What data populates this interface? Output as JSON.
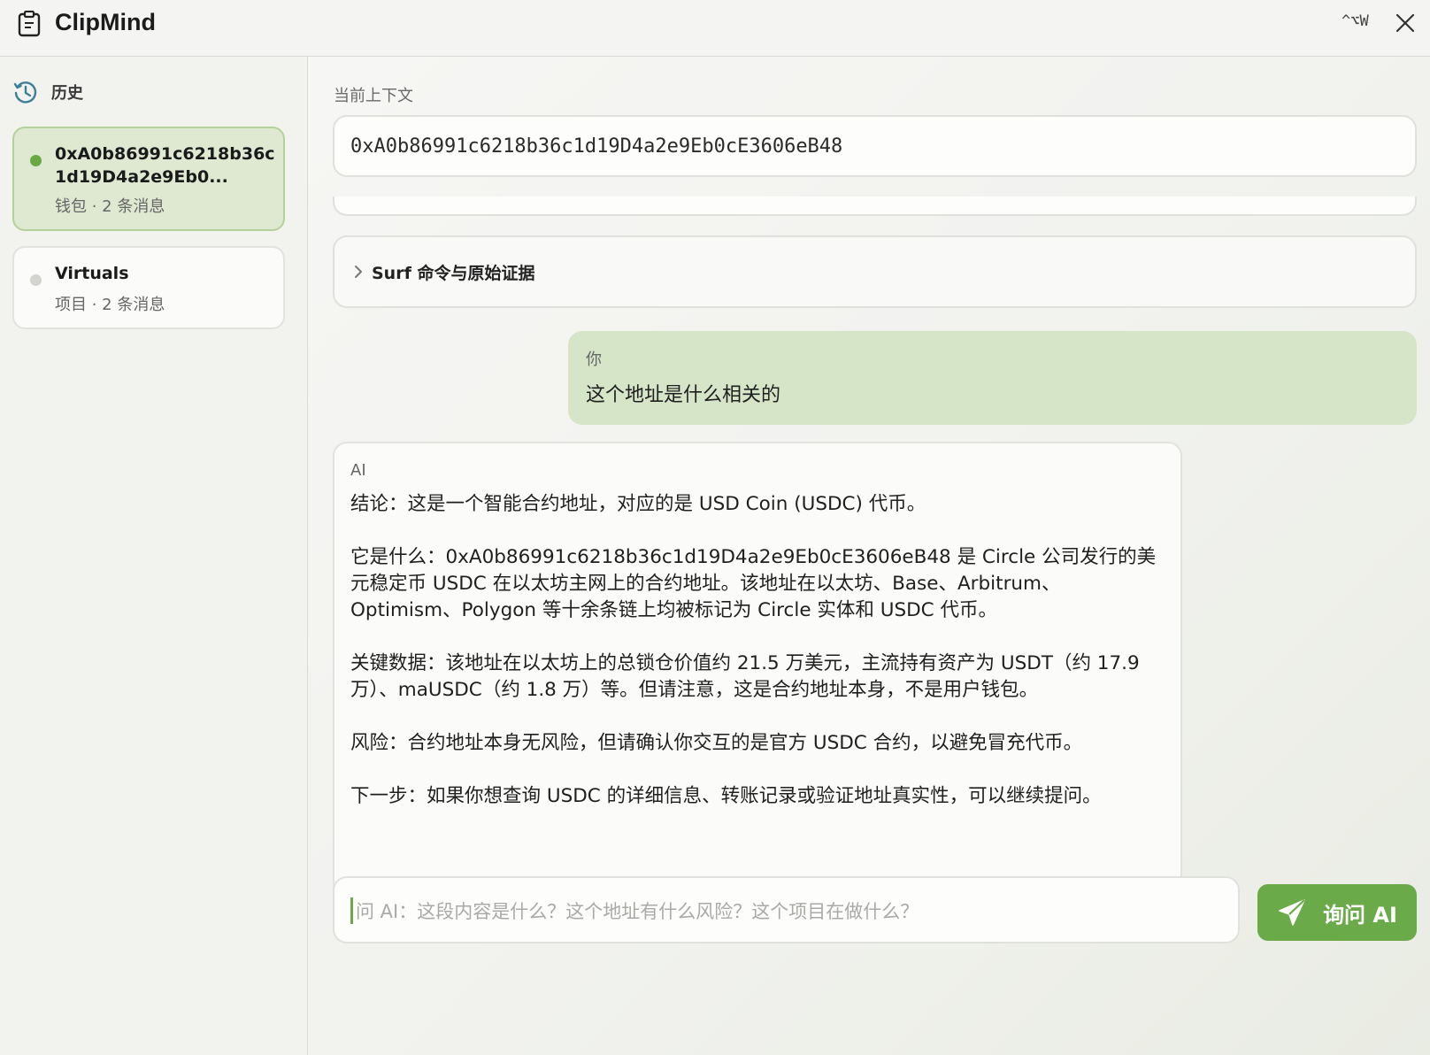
{
  "app": {
    "title": "ClipMind",
    "shortcut": "^⌥W"
  },
  "sidebar": {
    "history_label": "历史",
    "items": [
      {
        "title": "0xA0b86991c6218b36c1d19D4a2e9Eb0...",
        "meta": "钱包 · 2 条消息",
        "active": true
      },
      {
        "title": "Virtuals",
        "meta": "项目 · 2 条消息",
        "active": false
      }
    ]
  },
  "context": {
    "label": "当前上下文",
    "value": "0xA0b86991c6218b36c1d19D4a2e9Eb0cE3606eB48"
  },
  "surf": {
    "label": "Surf 命令与原始证据"
  },
  "messages": {
    "user": {
      "role": "你",
      "text": "这个地址是什么相关的"
    },
    "ai": {
      "role": "AI",
      "paragraphs": [
        "结论：这是一个智能合约地址，对应的是 USD Coin (USDC) 代币。",
        "它是什么：0xA0b86991c6218b36c1d19D4a2e9Eb0cE3606eB48 是 Circle 公司发行的美元稳定币 USDC 在以太坊主网上的合约地址。该地址在以太坊、Base、Arbitrum、Optimism、Polygon 等十余条链上均被标记为 Circle 实体和 USDC 代币。",
        "关键数据：该地址在以太坊上的总锁仓价值约 21.5 万美元，主流持有资产为 USDT（约 17.9 万）、maUSDC（约 1.8 万）等。但请注意，这是合约地址本身，不是用户钱包。",
        "风险：合约地址本身无风险，但请确认你交互的是官方 USDC 合约，以避免冒充代币。",
        "下一步：如果你想查询 USDC 的详细信息、转账记录或验证地址真实性，可以继续提问。"
      ]
    }
  },
  "ask": {
    "placeholder": "问 AI：这段内容是什么？这个地址有什么风险？这个项目在做什么？",
    "button_label": "询问 AI"
  },
  "colors": {
    "accent": "#6aaa48",
    "user_bubble": "#d6e4c8",
    "active_item": "#dfe9d2"
  }
}
